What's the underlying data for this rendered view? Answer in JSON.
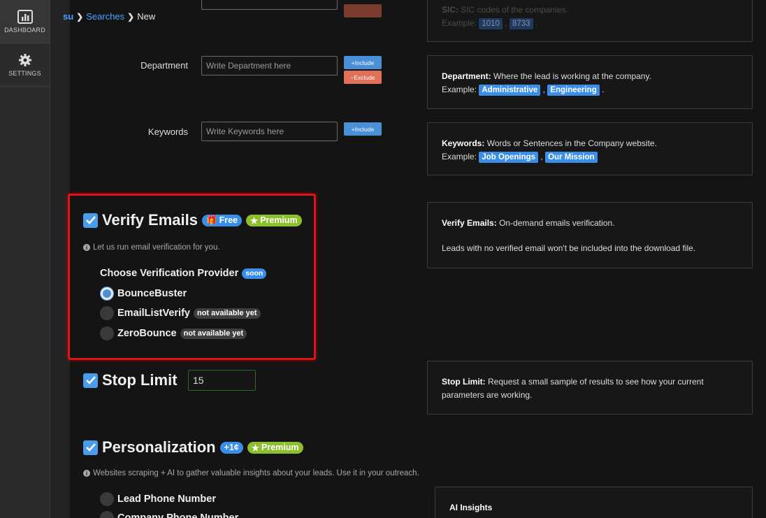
{
  "sidebar": {
    "items": [
      {
        "label": "DASHBOARD",
        "icon": "bar-chart-icon"
      },
      {
        "label": "SETTINGS",
        "icon": "gear-icon"
      }
    ]
  },
  "breadcrumb": {
    "root": "su",
    "searches": "Searches",
    "current": "New"
  },
  "sic_help": {
    "title": "SIC:",
    "text": "SIC codes of the companies.",
    "example_label": "Example:",
    "tags": [
      "1010",
      "8733"
    ]
  },
  "department": {
    "label": "Department",
    "placeholder": "Write Department here",
    "include_label": "Include",
    "exclude_label": "Exclude",
    "help_title": "Department:",
    "help_text": "Where the lead is working at the company.",
    "example_label": "Example:",
    "tags": [
      "Administrative",
      "Engineering"
    ]
  },
  "keywords": {
    "label": "Keywords",
    "placeholder": "Write Keywords here",
    "include_label": "Include",
    "help_title": "Keywords:",
    "help_text": "Words or Sentences in the Company website.",
    "example_label": "Example:",
    "tags": [
      "Job Openings",
      "Our Mission"
    ]
  },
  "verify_emails": {
    "title": "Verify Emails",
    "checked": true,
    "badge_free": "Free",
    "badge_premium": "Premium",
    "note": "Let us run email verification for you.",
    "provider_title": "Choose Verification Provider",
    "provider_badge": "soon",
    "providers": [
      {
        "label": "BounceBuster",
        "selected": true,
        "badge": ""
      },
      {
        "label": "EmailListVerify",
        "selected": false,
        "badge": "not available yet"
      },
      {
        "label": "ZeroBounce",
        "selected": false,
        "badge": "not available yet"
      }
    ],
    "help_title": "Verify Emails:",
    "help_text": "On-demand emails verification.",
    "help_text2": "Leads with no verified email won't be included into the download file."
  },
  "stop_limit": {
    "title": "Stop Limit",
    "checked": true,
    "value": "15",
    "help_title": "Stop Limit:",
    "help_text": "Request a small sample of results to see how your current parameters are working."
  },
  "personalization": {
    "title": "Personalization",
    "checked": true,
    "badge_cost": "+1¢",
    "badge_premium": "Premium",
    "note": "Websites scraping + AI to gather valuable insights about your leads. Use it in your outreach.",
    "options": [
      "Lead Phone Number",
      "Company Phone Number"
    ],
    "help_title": "AI Insights"
  },
  "colors": {
    "accent": "#3b8ee8",
    "premium": "#8cbf2c",
    "exclude": "#e0705a",
    "highlight": "#e01414"
  }
}
